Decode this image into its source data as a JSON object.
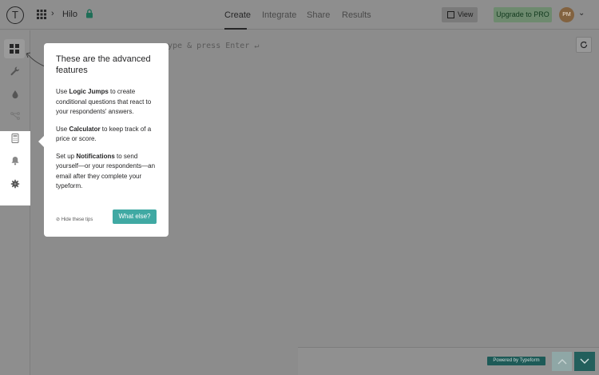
{
  "topbar": {
    "logo_letter": "T",
    "workspace_name": "Hilo",
    "tabs": [
      {
        "label": "Create"
      },
      {
        "label": "Integrate"
      },
      {
        "label": "Share"
      },
      {
        "label": "Results"
      }
    ],
    "view_label": "View",
    "upgrade_label": "Upgrade to PRO",
    "avatar_initials": "PM"
  },
  "canvas": {
    "placeholder": "ype & press Enter ↵"
  },
  "tooltip": {
    "title": "These are the advanced features",
    "p1": {
      "pre": "Use ",
      "bold": "Logic Jumps",
      "post": " to create conditional questions that react to your respondents' answers."
    },
    "p2": {
      "pre": "Use ",
      "bold": "Calculator",
      "post": " to keep track of a price or score."
    },
    "p3": {
      "pre": "Set up ",
      "bold": "Notifications",
      "post": " to send yourself—or your respondents—an email after they complete your typeform."
    },
    "hide_tips": "⊘ Hide these tips",
    "cta": "What else?"
  },
  "footer": {
    "powered_by": "Powered by Typeform"
  },
  "icons": {
    "sidebar": [
      "grid-icon",
      "wrench-icon",
      "drop-icon",
      "logic-jump-icon",
      "calculator-icon",
      "bell-icon",
      "gear-icon"
    ]
  },
  "colors": {
    "accent": "#40a9a3",
    "dark_teal": "#225f5c"
  }
}
